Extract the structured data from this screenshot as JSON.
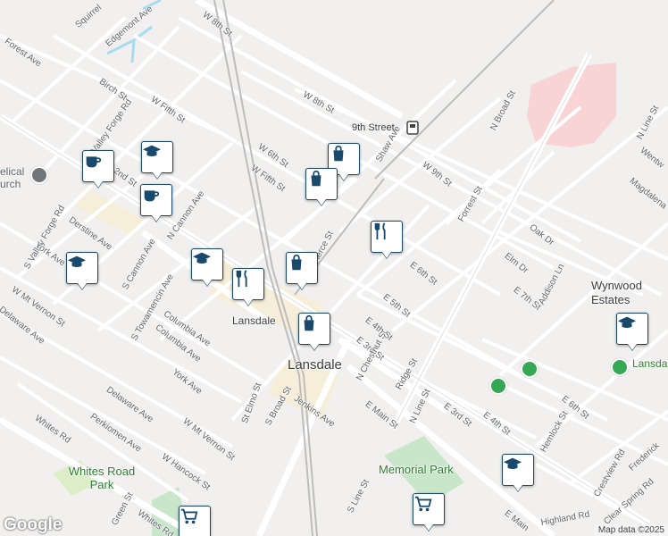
{
  "map": {
    "city_label": "Lansdale",
    "neighborhood_label": "Wynwood\nEstates",
    "station_label": "9th Street",
    "station_label_2": "Lansdale",
    "parks": [
      "Memorial Park",
      "Whites Road Park"
    ],
    "poi_partial": [
      "Lansdale & Recr",
      "elical urch"
    ],
    "streets": [
      "W 8th St",
      "W 8th St",
      "W Fifth St",
      "W 6th St",
      "W Fifth St",
      "Birch St",
      "Forest Ave",
      "Squirrel",
      "Edgemont Ave",
      "Valley Forge Rd",
      "2nd St",
      "Derstine Ave",
      "S Valley Forge Rd",
      "York Ave",
      "S Cannon Ave",
      "N Cannon Ave",
      "S Towamencin Ave",
      "Columbia Ave",
      "W Mt Vernon St",
      "Delaware Ave",
      "Perkiomen Ave",
      "Whites Rd",
      "W Hancock St",
      "Whites Rd",
      "St Elmo St",
      "S Broad St",
      "Jenkins Ave",
      "E Main St",
      "N Line St",
      "E 3rd St",
      "Ridge St",
      "N Chestnut St",
      "E 4th St",
      "E 5th St",
      "E 6th St",
      "E 7th St",
      "Shaw Ave",
      "W 9th St",
      "Forrest St",
      "Oak Dr",
      "Elm Dr",
      "Addison Ln",
      "N Broad St",
      "N Line St",
      "Magdalena",
      "Wentw",
      "E 6th St",
      "Hemlock St",
      "Crestview Rd",
      "Clear Spring Rd",
      "Frederick",
      "Highland Rd",
      "E Main",
      "S Line St",
      "E 4th St",
      "E 3rd St",
      "Pierce St",
      "York Ave",
      "Delaware Ave",
      "Columbia Ave",
      "W Mt Vernon St",
      "Green St"
    ],
    "poi_icons": [
      "shopping-bag-icon",
      "shopping-bag-icon",
      "restaurant-icon",
      "graduation-cap-icon",
      "coffee-cup-icon",
      "coffee-cup-icon",
      "graduation-cap-icon",
      "graduation-cap-icon",
      "graduation-cap-icon",
      "restaurant-icon",
      "shopping-bag-icon",
      "shopping-bag-icon",
      "shopping-cart-icon",
      "shopping-cart-icon",
      "graduation-cap-icon"
    ],
    "google_logo": "Google",
    "attribution": "Map data ©2025"
  }
}
